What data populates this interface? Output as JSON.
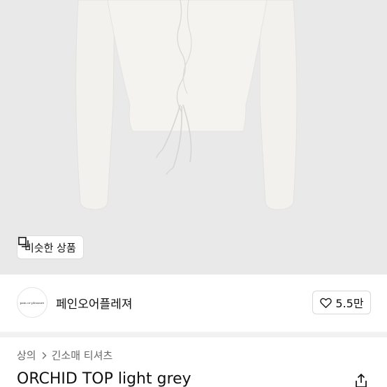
{
  "photo": {
    "similar_label": "비슷한 상품",
    "colors": {
      "background": "#e9e9e9",
      "garment": "#f2f1ee"
    }
  },
  "brand": {
    "logo_text": "pain or pleasure",
    "name": "페인오어플레져",
    "like_count": "5.5만"
  },
  "breadcrumb": {
    "items": [
      "상의",
      "긴소매 티셔츠"
    ]
  },
  "product": {
    "title": "ORCHID TOP light grey"
  },
  "icons": {
    "similar": "similar-items-icon",
    "like": "heart-icon",
    "separator": "chevron-right-icon",
    "share": "share-icon"
  }
}
